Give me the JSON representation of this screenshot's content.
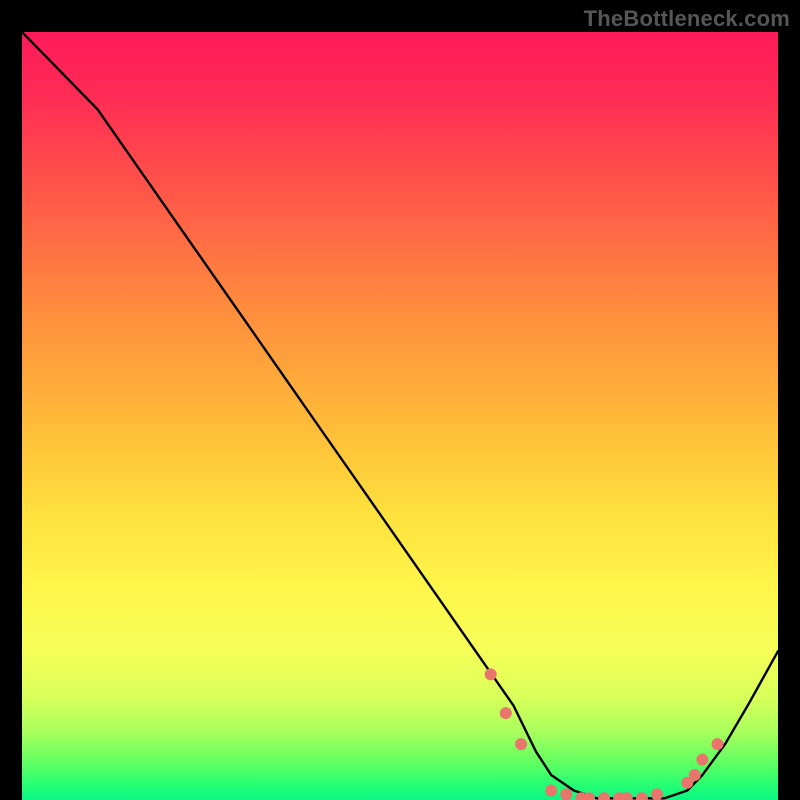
{
  "attribution": "TheBottleneck.com",
  "colors": {
    "curve": "#000000",
    "marker": "#e8766d",
    "gradient_top": "#ff1a58",
    "gradient_mid": "#fff64a",
    "gradient_bottom": "#00f28c"
  },
  "chart_data": {
    "type": "line",
    "title": "",
    "xlabel": "",
    "ylabel": "",
    "xlim": [
      0,
      100
    ],
    "ylim": [
      0,
      100
    ],
    "grid": false,
    "legend": false,
    "series": [
      {
        "name": "bottleneck-curve",
        "x": [
          0,
          10,
          20,
          30,
          40,
          50,
          60,
          65,
          68,
          70,
          73,
          76,
          80,
          83,
          85,
          88,
          90,
          93,
          96,
          100
        ],
        "y": [
          100,
          90,
          76,
          62,
          48,
          34,
          20,
          13,
          7,
          4,
          2,
          1,
          1,
          1,
          1,
          2,
          4,
          8,
          13,
          20
        ]
      }
    ],
    "markers": [
      {
        "x": 62,
        "y": 17
      },
      {
        "x": 64,
        "y": 12
      },
      {
        "x": 66,
        "y": 8
      },
      {
        "x": 70,
        "y": 2
      },
      {
        "x": 72,
        "y": 1.5
      },
      {
        "x": 74,
        "y": 1
      },
      {
        "x": 75,
        "y": 1
      },
      {
        "x": 77,
        "y": 1
      },
      {
        "x": 79,
        "y": 1
      },
      {
        "x": 80,
        "y": 1
      },
      {
        "x": 82,
        "y": 1
      },
      {
        "x": 84,
        "y": 1.5
      },
      {
        "x": 88,
        "y": 3
      },
      {
        "x": 89,
        "y": 4
      },
      {
        "x": 90,
        "y": 6
      },
      {
        "x": 92,
        "y": 8
      }
    ]
  }
}
